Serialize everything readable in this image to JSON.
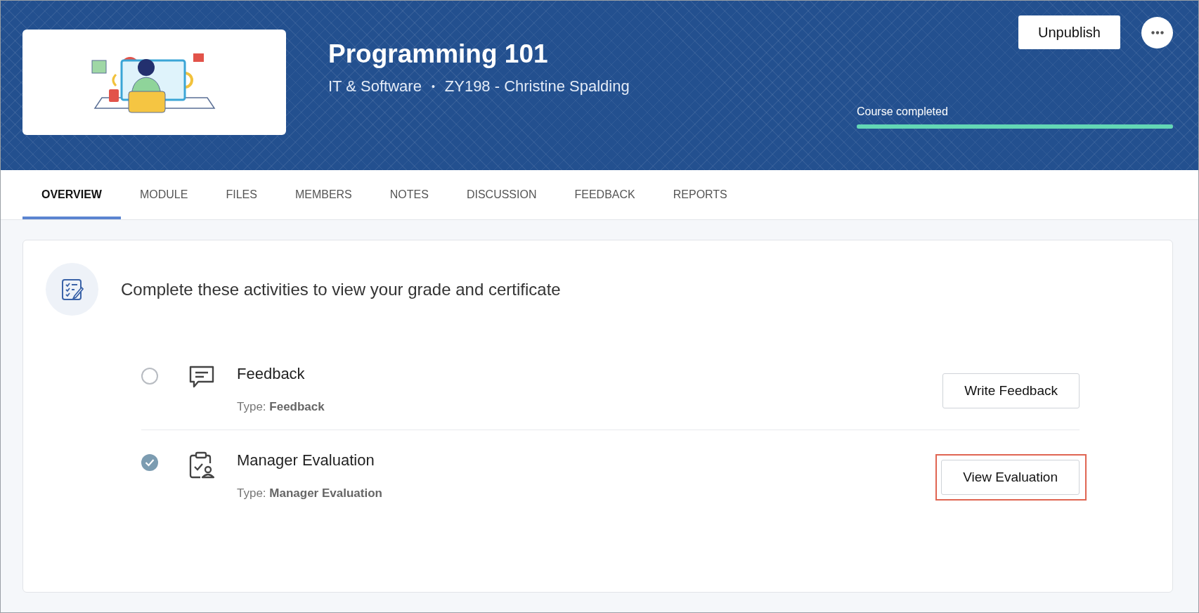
{
  "course": {
    "title": "Programming 101",
    "category": "IT & Software",
    "separator": "•",
    "instructor": "ZY198 - Christine Spalding",
    "primary_action": "Unpublish",
    "progress": {
      "label": "Course completed",
      "level": 1
    }
  },
  "tabs": [
    {
      "label": "OVERVIEW",
      "selected": true
    },
    {
      "label": "MODULE",
      "selected": false
    },
    {
      "label": "FILES",
      "selected": false
    },
    {
      "label": "MEMBERS",
      "selected": false
    },
    {
      "label": "NOTES",
      "selected": false
    },
    {
      "label": "DISCUSSION",
      "selected": false
    },
    {
      "label": "FEEDBACK",
      "selected": false
    },
    {
      "label": "REPORTS",
      "selected": false
    }
  ],
  "activities": {
    "heading": "Complete these activities to view your grade and certificate",
    "items": [
      {
        "kind": "feedback",
        "title": "Feedback",
        "type": "Type: **Feedback**",
        "completed": false,
        "action": "Write Feedback",
        "highlighted": false
      },
      {
        "kind": "evaluation",
        "title": "Manager Evaluation",
        "type": "Type: **Manager Evaluation**",
        "completed": true,
        "action": "View Evaluation",
        "highlighted": true
      }
    ]
  }
}
